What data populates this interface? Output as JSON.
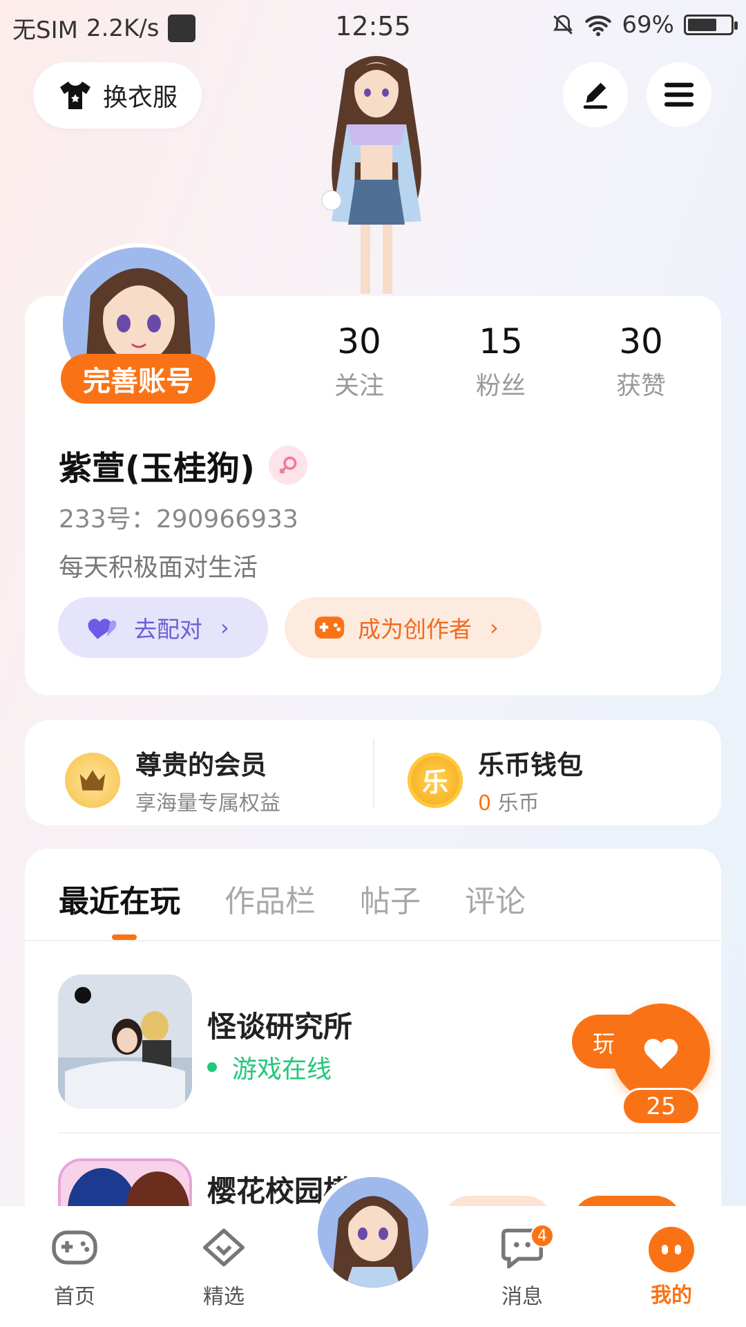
{
  "status_bar": {
    "sim": "无SIM",
    "speed": "2.2K/s",
    "time": "12:55",
    "battery": "69%"
  },
  "header": {
    "dress_up_label": "换衣服"
  },
  "profile": {
    "complete_account_label": "完善账号",
    "stats": [
      {
        "value": "30",
        "label": "关注"
      },
      {
        "value": "15",
        "label": "粉丝"
      },
      {
        "value": "30",
        "label": "获赞"
      }
    ],
    "name": "紫萱(玉桂狗)",
    "id_text": "233号：290966933",
    "bio": "每天积极面对生活",
    "pair_label": "去配对",
    "creator_label": "成为创作者"
  },
  "vip": {
    "title": "尊贵的会员",
    "subtitle": "享海量专属权益"
  },
  "wallet": {
    "title": "乐币钱包",
    "coin_glyph": "乐",
    "amount": "0",
    "unit": "乐币"
  },
  "tabs": [
    {
      "label": "最近在玩"
    },
    {
      "label": "作品栏"
    },
    {
      "label": "帖子"
    },
    {
      "label": "评论"
    }
  ],
  "games": [
    {
      "title": "怪谈研究所",
      "status": "游戏在线",
      "play_label": "玩"
    },
    {
      "title": "樱花校园模"
    }
  ],
  "floating": {
    "like_count": "25"
  },
  "nav": {
    "items": [
      {
        "label": "首页"
      },
      {
        "label": "精选"
      },
      {
        "label": "消息",
        "badge": "4"
      },
      {
        "label": "我的"
      }
    ]
  },
  "colors": {
    "accent": "#f97316",
    "purple": "#7d6fe0",
    "online_green": "#22c77a"
  }
}
